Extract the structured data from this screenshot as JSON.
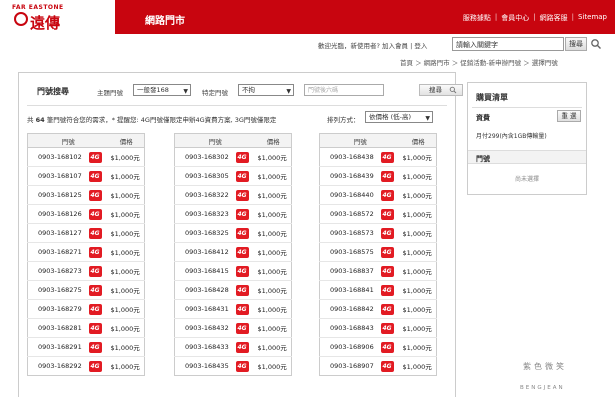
{
  "header": {
    "logo_small": "FAR EASTONE",
    "logo_big": "遠傳",
    "store_title": "網路門市",
    "links": [
      "服務據點",
      "會員中心",
      "網路客服",
      "Sitemap"
    ]
  },
  "welcome": "歡迎光臨，新使用者? 加入會員 | 登入",
  "search": {
    "value": "請輸入關鍵字",
    "button": "搜尋"
  },
  "breadcrumb": "首頁 ＞ 網路門市 ＞ 促銷活動-新申辦門號 ＞ 選擇門號",
  "filter": {
    "title": "門號搜尋",
    "prefix_label": "主題門號",
    "prefix_value": "一般發168",
    "special_label": "特定門號",
    "special_value": "不拘",
    "num_placeholder": "門號後六碼",
    "search_button": "搜尋"
  },
  "info": {
    "count_prefix": "共",
    "count": "64",
    "count_suffix": "筆門號符合您的需求，* 提醒您: 4G門號僅限定申辦4G資費方案, 3G門號僅限定",
    "sort_label": "排列方式：",
    "sort_value": "依價格 (低-高)"
  },
  "table": {
    "col_number": "門號",
    "col_price": "價格",
    "badge": "4G",
    "columns": [
      [
        {
          "number": "0903-168102",
          "price": "$1,000元"
        },
        {
          "number": "0903-168107",
          "price": "$1,000元"
        },
        {
          "number": "0903-168125",
          "price": "$1,000元"
        },
        {
          "number": "0903-168126",
          "price": "$1,000元"
        },
        {
          "number": "0903-168127",
          "price": "$1,000元"
        },
        {
          "number": "0903-168271",
          "price": "$1,000元"
        },
        {
          "number": "0903-168273",
          "price": "$1,000元"
        },
        {
          "number": "0903-168275",
          "price": "$1,000元"
        },
        {
          "number": "0903-168279",
          "price": "$1,000元"
        },
        {
          "number": "0903-168281",
          "price": "$1,000元"
        },
        {
          "number": "0903-168291",
          "price": "$1,000元"
        },
        {
          "number": "0903-168292",
          "price": "$1,000元"
        }
      ],
      [
        {
          "number": "0903-168302",
          "price": "$1,000元"
        },
        {
          "number": "0903-168305",
          "price": "$1,000元"
        },
        {
          "number": "0903-168322",
          "price": "$1,000元"
        },
        {
          "number": "0903-168323",
          "price": "$1,000元"
        },
        {
          "number": "0903-168325",
          "price": "$1,000元"
        },
        {
          "number": "0903-168412",
          "price": "$1,000元"
        },
        {
          "number": "0903-168415",
          "price": "$1,000元"
        },
        {
          "number": "0903-168428",
          "price": "$1,000元"
        },
        {
          "number": "0903-168431",
          "price": "$1,000元"
        },
        {
          "number": "0903-168432",
          "price": "$1,000元"
        },
        {
          "number": "0903-168433",
          "price": "$1,000元"
        },
        {
          "number": "0903-168435",
          "price": "$1,000元"
        }
      ],
      [
        {
          "number": "0903-168438",
          "price": "$1,000元"
        },
        {
          "number": "0903-168439",
          "price": "$1,000元"
        },
        {
          "number": "0903-168440",
          "price": "$1,000元"
        },
        {
          "number": "0903-168572",
          "price": "$1,000元"
        },
        {
          "number": "0903-168573",
          "price": "$1,000元"
        },
        {
          "number": "0903-168575",
          "price": "$1,000元"
        },
        {
          "number": "0903-168837",
          "price": "$1,000元"
        },
        {
          "number": "0903-168841",
          "price": "$1,000元"
        },
        {
          "number": "0903-168842",
          "price": "$1,000元"
        },
        {
          "number": "0903-168843",
          "price": "$1,000元"
        },
        {
          "number": "0903-168906",
          "price": "$1,000元"
        },
        {
          "number": "0903-168907",
          "price": "$1,000元"
        }
      ]
    ]
  },
  "side": {
    "title": "購買清單",
    "fee_label": "資費",
    "reset": "重 選",
    "plan": "月付299(內含1GB傳輸量)",
    "num_label": "門號",
    "empty": "尚未選擇"
  },
  "watermark": {
    "main": "紫色微笑",
    "sub": "BENGJEAN"
  }
}
